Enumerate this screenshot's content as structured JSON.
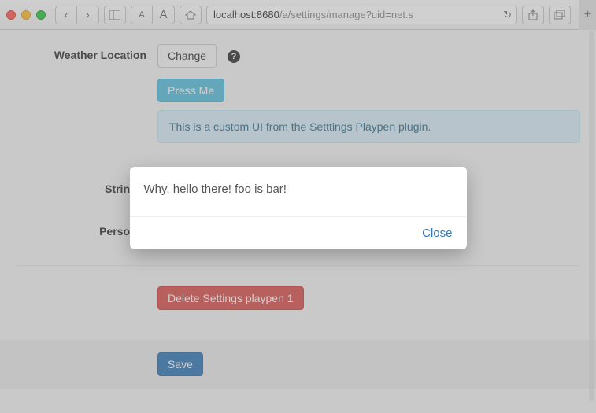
{
  "chrome": {
    "url_host": "localhost:8680",
    "url_path": "/a/settings/manage?uid=net.s",
    "font_small": "A",
    "font_large": "A"
  },
  "settings": {
    "weather_label": "Weather Location",
    "change_btn": "Change",
    "press_me_btn": "Press Me",
    "info_text": "This is a custom UI from the Setttings Playpen plugin.",
    "string_label": "String L",
    "person_label": "Person L",
    "delete_btn": "Delete Settings playpen 1",
    "save_btn": "Save"
  },
  "modal": {
    "message": "Why, hello there! foo is bar!",
    "close": "Close"
  }
}
